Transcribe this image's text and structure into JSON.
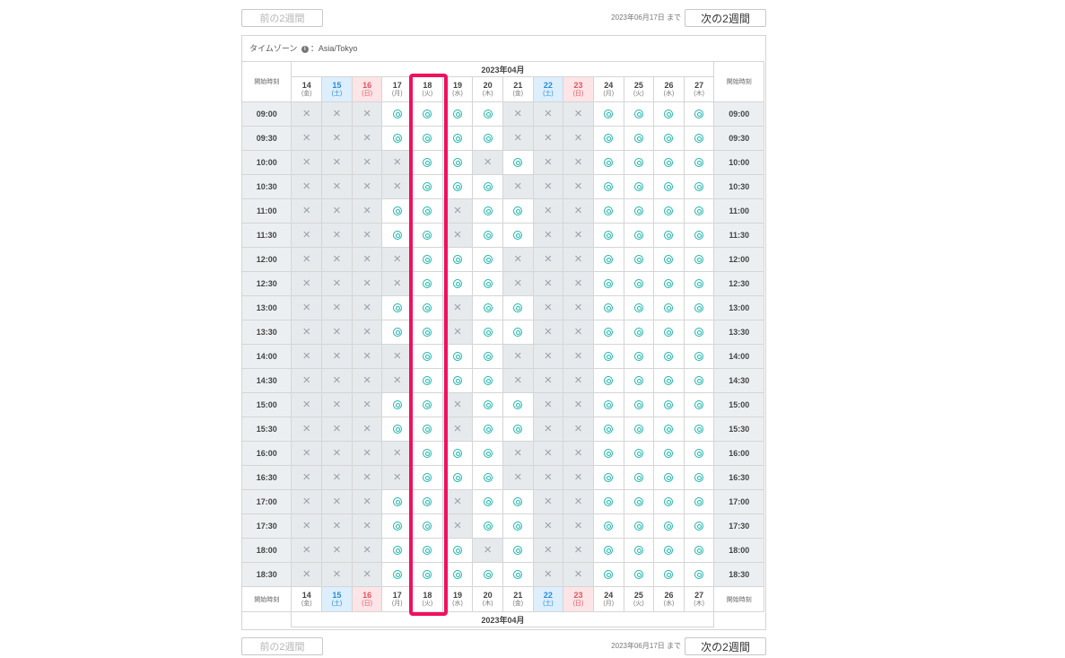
{
  "nav": {
    "prev_label": "前の2週間",
    "next_label": "次の2週間",
    "until_text": "2023年06月17日 まで"
  },
  "timezone": {
    "label": "タイムゾーン",
    "info_icon": "info-icon",
    "value": "：Asia/Tokyo"
  },
  "month_label": "2023年04月",
  "start_time_label": "開始時刻",
  "days": [
    {
      "d": "14",
      "w": "(金)",
      "type": "weekday"
    },
    {
      "d": "15",
      "w": "(土)",
      "type": "sat"
    },
    {
      "d": "16",
      "w": "(日)",
      "type": "sun"
    },
    {
      "d": "17",
      "w": "(月)",
      "type": "weekday"
    },
    {
      "d": "18",
      "w": "(火)",
      "type": "weekday"
    },
    {
      "d": "19",
      "w": "(水)",
      "type": "weekday"
    },
    {
      "d": "20",
      "w": "(木)",
      "type": "weekday"
    },
    {
      "d": "21",
      "w": "(金)",
      "type": "weekday"
    },
    {
      "d": "22",
      "w": "(土)",
      "type": "sat"
    },
    {
      "d": "23",
      "w": "(日)",
      "type": "sun"
    },
    {
      "d": "24",
      "w": "(月)",
      "type": "weekday"
    },
    {
      "d": "25",
      "w": "(火)",
      "type": "weekday"
    },
    {
      "d": "26",
      "w": "(水)",
      "type": "weekday"
    },
    {
      "d": "27",
      "w": "(木)",
      "type": "weekday"
    }
  ],
  "slots": [
    {
      "time": "09:00",
      "avail": "xxxooooxxxoooo"
    },
    {
      "time": "09:30",
      "avail": "xxxooooxxxoooo"
    },
    {
      "time": "10:00",
      "avail": "xxxxooxoxxoooo"
    },
    {
      "time": "10:30",
      "avail": "xxxxoooxxxoooo"
    },
    {
      "time": "11:00",
      "avail": "xxxooxooxxoooo"
    },
    {
      "time": "11:30",
      "avail": "xxxooxooxxoooo"
    },
    {
      "time": "12:00",
      "avail": "xxxxoooxxxoooo"
    },
    {
      "time": "12:30",
      "avail": "xxxxoooxxxoooo"
    },
    {
      "time": "13:00",
      "avail": "xxxooxooxxoooo"
    },
    {
      "time": "13:30",
      "avail": "xxxooxooxxoooo"
    },
    {
      "time": "14:00",
      "avail": "xxxxoooxxxoooo"
    },
    {
      "time": "14:30",
      "avail": "xxxxoooxxxoooo"
    },
    {
      "time": "15:00",
      "avail": "xxxooxooxxoooo"
    },
    {
      "time": "15:30",
      "avail": "xxxooxooxxoooo"
    },
    {
      "time": "16:00",
      "avail": "xxxxoooxxxoooo"
    },
    {
      "time": "16:30",
      "avail": "xxxxoooxxxoooo"
    },
    {
      "time": "17:00",
      "avail": "xxxooxooxxoooo"
    },
    {
      "time": "17:30",
      "avail": "xxxooxooxxoooo"
    },
    {
      "time": "18:00",
      "avail": "xxxoooxoxxoooo"
    },
    {
      "time": "18:30",
      "avail": "xxxoooooxxoooo"
    }
  ],
  "marks": {
    "available": "◎",
    "unavailable": "×"
  },
  "colors": {
    "highlight": "#f0105e",
    "available": "#1fb5ad",
    "saturday": "#2a8cd6",
    "sunday": "#e05561"
  }
}
